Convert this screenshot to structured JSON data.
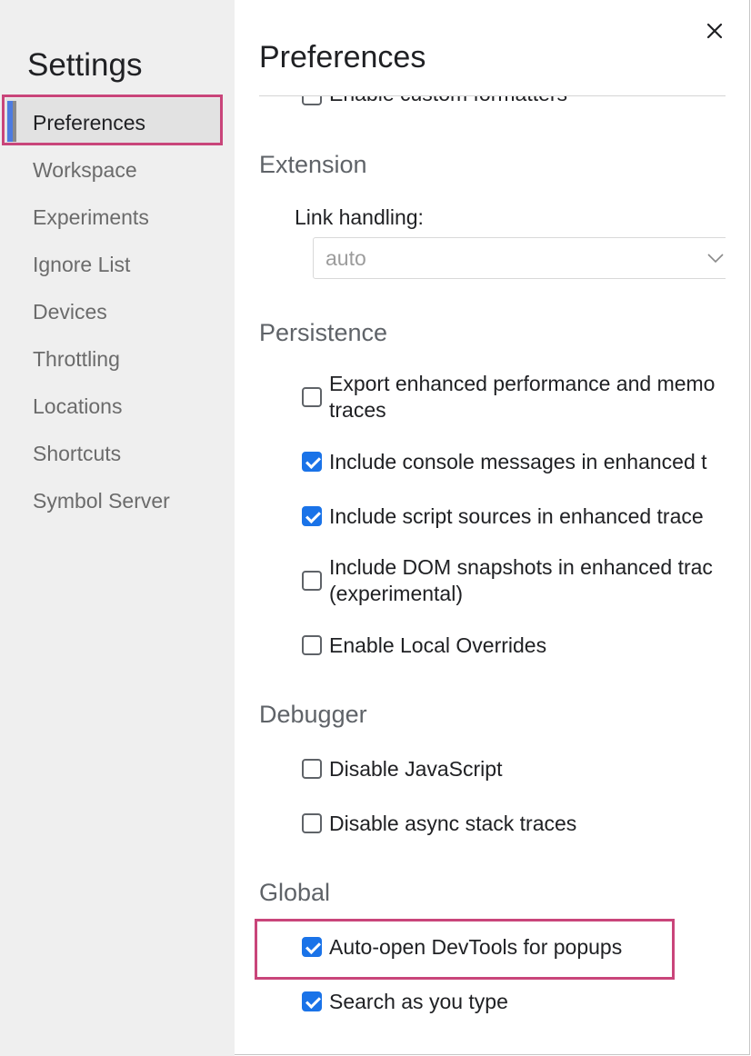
{
  "sidebar": {
    "title": "Settings",
    "items": [
      {
        "label": "Preferences",
        "selected": true
      },
      {
        "label": "Workspace"
      },
      {
        "label": "Experiments"
      },
      {
        "label": "Ignore List"
      },
      {
        "label": "Devices"
      },
      {
        "label": "Throttling"
      },
      {
        "label": "Locations"
      },
      {
        "label": "Shortcuts"
      },
      {
        "label": "Symbol Server"
      }
    ]
  },
  "main": {
    "title": "Preferences",
    "close_icon": "close-icon",
    "partial_option": "Enable custom formatters",
    "extension": {
      "heading": "Extension",
      "link_handling_label": "Link handling:",
      "link_handling_value": "auto"
    },
    "persistence": {
      "heading": "Persistence",
      "options": [
        {
          "line1": "Export enhanced performance and memo",
          "line2": "traces",
          "checked": false
        },
        {
          "line1": "Include console messages in enhanced t",
          "checked": true
        },
        {
          "line1": "Include script sources in enhanced trace",
          "checked": true
        },
        {
          "line1": "Include DOM snapshots in enhanced trac",
          "line2": "(experimental)",
          "checked": false
        },
        {
          "line1": "Enable Local Overrides",
          "checked": false
        }
      ]
    },
    "debugger": {
      "heading": "Debugger",
      "options": [
        {
          "label": "Disable JavaScript",
          "checked": false
        },
        {
          "label": "Disable async stack traces",
          "checked": false
        }
      ]
    },
    "global": {
      "heading": "Global",
      "options": [
        {
          "label": "Auto-open DevTools for popups",
          "checked": true
        },
        {
          "label": "Search as you type",
          "checked": true
        }
      ]
    }
  },
  "colors": {
    "accent": "#1a73e8",
    "highlight": "#c9457a",
    "sidebar_bg": "#efefef"
  }
}
